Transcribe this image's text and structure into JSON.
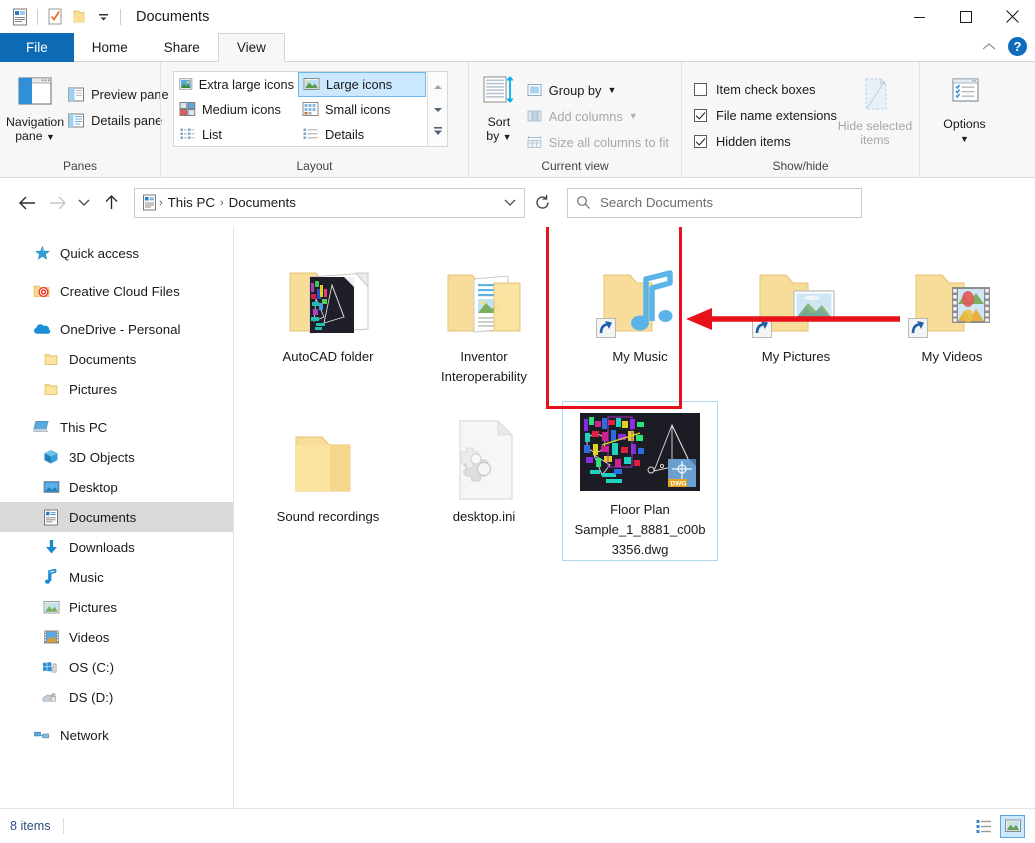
{
  "window": {
    "title": "Documents",
    "quick_access": [
      "documents-icon",
      "properties-icon",
      "new-folder-icon",
      "customize-dropdown"
    ],
    "controls": {
      "minimize": "─",
      "maximize": "☐",
      "close": "✕"
    }
  },
  "tabs": [
    {
      "label": "File",
      "active": false,
      "kind": "file"
    },
    {
      "label": "Home",
      "active": false
    },
    {
      "label": "Share",
      "active": false
    },
    {
      "label": "View",
      "active": true
    }
  ],
  "ribbon": {
    "collapse_label": "⌃",
    "help_label": "?",
    "groups": [
      {
        "label": "Panes",
        "big": {
          "label": "Navigation\npane",
          "name": "navigation-pane-button",
          "has_dropdown": true
        },
        "small": [
          {
            "label": "Preview pane",
            "name": "preview-pane-button",
            "disabled": false
          },
          {
            "label": "Details pane",
            "name": "details-pane-button",
            "disabled": false
          }
        ]
      },
      {
        "label": "Layout",
        "gallery": [
          {
            "label": "Extra large icons",
            "selected": false
          },
          {
            "label": "Large icons",
            "selected": true
          },
          {
            "label": "Medium icons",
            "selected": false
          },
          {
            "label": "Small icons",
            "selected": false
          },
          {
            "label": "List",
            "selected": false
          },
          {
            "label": "Details",
            "selected": false
          }
        ]
      },
      {
        "label": "Current view",
        "big": {
          "label": "Sort\nby",
          "name": "sort-by-button",
          "has_dropdown": true
        },
        "small": [
          {
            "label": "Group by",
            "name": "group-by-button",
            "disabled": false,
            "has_dropdown": true
          },
          {
            "label": "Add columns",
            "name": "add-columns-button",
            "disabled": true,
            "has_dropdown": true
          },
          {
            "label": "Size all columns to fit",
            "name": "size-all-columns-button",
            "disabled": true
          }
        ]
      },
      {
        "label": "Show/hide",
        "checks": [
          {
            "label": "Item check boxes",
            "checked": false
          },
          {
            "label": "File name extensions",
            "checked": true
          },
          {
            "label": "Hidden items",
            "checked": true
          }
        ],
        "big": {
          "label": "Hide selected\nitems",
          "name": "hide-selected-items-button",
          "disabled": true
        }
      },
      {
        "label": "",
        "big": {
          "label": "Options",
          "name": "options-button",
          "has_dropdown": true
        }
      }
    ]
  },
  "address": {
    "back": "←",
    "forward": "→",
    "recent": "⌄",
    "up": "↑",
    "crumbs": [
      "This PC",
      "Documents"
    ],
    "separator": "›",
    "dropdown": "⌄",
    "refresh": "↻"
  },
  "search": {
    "placeholder": "Search Documents",
    "icon": "search-icon"
  },
  "sidebar": {
    "items": [
      {
        "label": "Quick access",
        "icon": "star-icon",
        "level": 0,
        "selected": false,
        "gap_before": false
      },
      {
        "label": "Creative Cloud Files",
        "icon": "creative-cloud-icon",
        "level": 0,
        "selected": false,
        "gap_before": true
      },
      {
        "label": "OneDrive - Personal",
        "icon": "onedrive-icon",
        "level": 0,
        "selected": false,
        "gap_before": true
      },
      {
        "label": "Documents",
        "icon": "folder-icon",
        "level": 1,
        "selected": false,
        "gap_before": false
      },
      {
        "label": "Pictures",
        "icon": "folder-icon",
        "level": 1,
        "selected": false,
        "gap_before": false
      },
      {
        "label": "This PC",
        "icon": "pc-icon",
        "level": 0,
        "selected": false,
        "gap_before": true
      },
      {
        "label": "3D Objects",
        "icon": "3d-objects-icon",
        "level": 1,
        "selected": false,
        "gap_before": false
      },
      {
        "label": "Desktop",
        "icon": "desktop-icon",
        "level": 1,
        "selected": false,
        "gap_before": false
      },
      {
        "label": "Documents",
        "icon": "documents-icon",
        "level": 1,
        "selected": true,
        "gap_before": false
      },
      {
        "label": "Downloads",
        "icon": "downloads-icon",
        "level": 1,
        "selected": false,
        "gap_before": false
      },
      {
        "label": "Music",
        "icon": "music-icon",
        "level": 1,
        "selected": false,
        "gap_before": false
      },
      {
        "label": "Pictures",
        "icon": "pictures-icon",
        "level": 1,
        "selected": false,
        "gap_before": false
      },
      {
        "label": "Videos",
        "icon": "videos-icon",
        "level": 1,
        "selected": false,
        "gap_before": false
      },
      {
        "label": "OS (C:)",
        "icon": "os-drive-icon",
        "level": 1,
        "selected": false,
        "gap_before": false
      },
      {
        "label": "DS (D:)",
        "icon": "drive-icon",
        "level": 1,
        "selected": false,
        "gap_before": false
      },
      {
        "label": "Network",
        "icon": "network-icon",
        "level": 0,
        "selected": false,
        "gap_before": true
      }
    ]
  },
  "files": [
    {
      "name": "AutoCAD folder",
      "icon": "autocad-folder-icon",
      "selected": false,
      "shortcut": false
    },
    {
      "name": "Inventor Interoperability",
      "icon": "documents-folder-icon",
      "selected": false,
      "shortcut": false
    },
    {
      "name": "My Music",
      "icon": "music-folder-icon",
      "selected": false,
      "shortcut": true
    },
    {
      "name": "My Pictures",
      "icon": "pictures-folder-icon",
      "selected": false,
      "shortcut": true
    },
    {
      "name": "My Videos",
      "icon": "videos-folder-icon",
      "selected": false,
      "shortcut": true
    },
    {
      "name": "Sound recordings",
      "icon": "folder-icon",
      "selected": false,
      "shortcut": false
    },
    {
      "name": "desktop.ini",
      "icon": "ini-file-icon",
      "selected": false,
      "shortcut": false
    },
    {
      "name": "Floor Plan Sample_1_8881_c00b3356.dwg",
      "icon": "dwg-file-icon",
      "selected": true,
      "shortcut": false
    }
  ],
  "annotation": {
    "highlight_color": "#e8101a",
    "target": "Floor Plan Sample_1_8881_c00b3356.dwg"
  },
  "status": {
    "item_count": "8 items",
    "views": [
      {
        "name": "details-view-button",
        "selected": false
      },
      {
        "name": "large-icons-view-button",
        "selected": true
      }
    ]
  }
}
